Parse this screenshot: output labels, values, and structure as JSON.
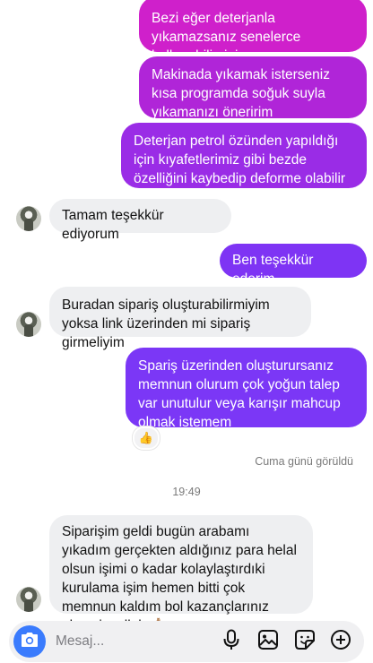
{
  "colors": {
    "outgoing_top": "#d01fc9",
    "outgoing_bottom": "#7e33f5",
    "incoming_bg": "#eeeff1",
    "accent_blue": "#3a7bfd"
  },
  "messages": [
    {
      "dir": "out",
      "text": "Bezi eğer deterjanla yıkamazsanız senelerce kullanabilirsiniz"
    },
    {
      "dir": "out",
      "text": "Makinada yıkamak isterseniz kısa programda soğuk suyla yıkamanızı öneririm"
    },
    {
      "dir": "out",
      "text": "Deterjan petrol özünden yapıldığı için kıyafetlerimiz gibi bezde özelliğini kaybedip deforme olabilir"
    },
    {
      "dir": "in",
      "text": "Tamam teşekkür ediyorum"
    },
    {
      "dir": "out",
      "text": "Ben teşekkür ederim"
    },
    {
      "dir": "in",
      "text": "Buradan sipariş oluşturabilirmiyim yoksa link üzerinden mi sipariş girmeliyim"
    },
    {
      "dir": "out",
      "text": "Spariş üzerinden oluşturursanız memnun olurum çok yoğun talep var unutulur veya karışır mahcup olmak istemem",
      "reaction": "👍"
    },
    {
      "dir": "in",
      "text": "Siparişim geldi bugün arabamı yıkadım gerçekten aldığınız para helal olsun işimi o kadar kolaylaştırdıki kurulama işim hemen bitti çok memnun kaldım bol kazançlarınız olsun inşallah 🙏🏼"
    }
  ],
  "seen_text": "Cuma günü görüldü",
  "timestamp": "19:49",
  "composer": {
    "placeholder": "Mesaj...",
    "icons": [
      "camera-icon",
      "microphone-icon",
      "gallery-icon",
      "sticker-icon",
      "add-icon"
    ]
  }
}
